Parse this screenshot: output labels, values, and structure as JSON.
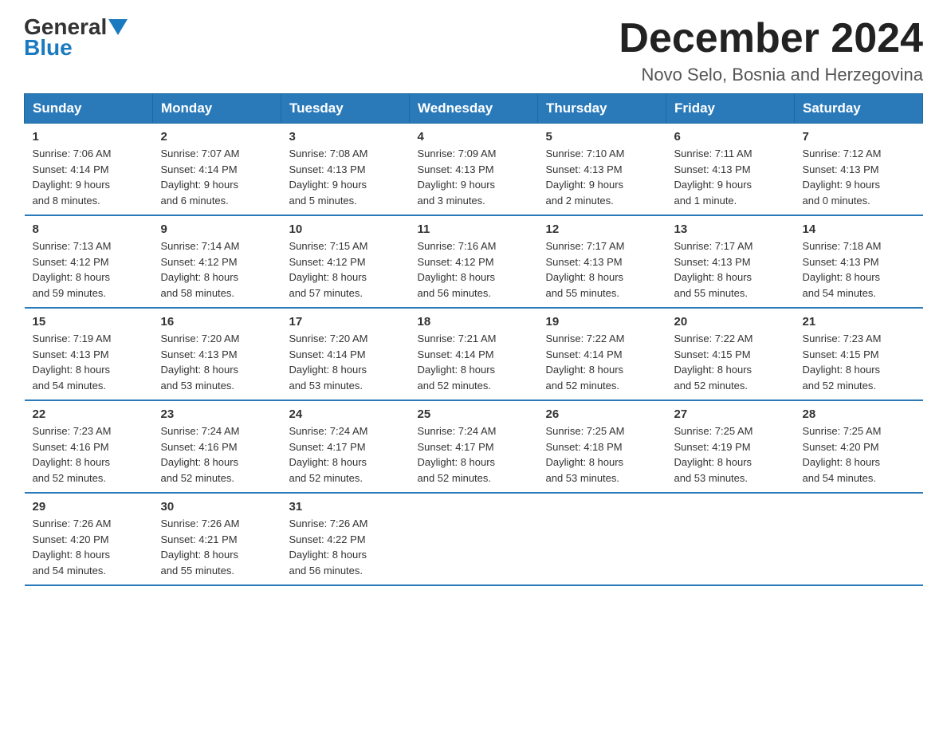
{
  "logo": {
    "general": "General",
    "blue": "Blue"
  },
  "title": "December 2024",
  "location": "Novo Selo, Bosnia and Herzegovina",
  "headers": [
    "Sunday",
    "Monday",
    "Tuesday",
    "Wednesday",
    "Thursday",
    "Friday",
    "Saturday"
  ],
  "weeks": [
    [
      {
        "day": "1",
        "sunrise": "7:06 AM",
        "sunset": "4:14 PM",
        "daylight": "9 hours and 8 minutes."
      },
      {
        "day": "2",
        "sunrise": "7:07 AM",
        "sunset": "4:14 PM",
        "daylight": "9 hours and 6 minutes."
      },
      {
        "day": "3",
        "sunrise": "7:08 AM",
        "sunset": "4:13 PM",
        "daylight": "9 hours and 5 minutes."
      },
      {
        "day": "4",
        "sunrise": "7:09 AM",
        "sunset": "4:13 PM",
        "daylight": "9 hours and 3 minutes."
      },
      {
        "day": "5",
        "sunrise": "7:10 AM",
        "sunset": "4:13 PM",
        "daylight": "9 hours and 2 minutes."
      },
      {
        "day": "6",
        "sunrise": "7:11 AM",
        "sunset": "4:13 PM",
        "daylight": "9 hours and 1 minute."
      },
      {
        "day": "7",
        "sunrise": "7:12 AM",
        "sunset": "4:13 PM",
        "daylight": "9 hours and 0 minutes."
      }
    ],
    [
      {
        "day": "8",
        "sunrise": "7:13 AM",
        "sunset": "4:12 PM",
        "daylight": "8 hours and 59 minutes."
      },
      {
        "day": "9",
        "sunrise": "7:14 AM",
        "sunset": "4:12 PM",
        "daylight": "8 hours and 58 minutes."
      },
      {
        "day": "10",
        "sunrise": "7:15 AM",
        "sunset": "4:12 PM",
        "daylight": "8 hours and 57 minutes."
      },
      {
        "day": "11",
        "sunrise": "7:16 AM",
        "sunset": "4:12 PM",
        "daylight": "8 hours and 56 minutes."
      },
      {
        "day": "12",
        "sunrise": "7:17 AM",
        "sunset": "4:13 PM",
        "daylight": "8 hours and 55 minutes."
      },
      {
        "day": "13",
        "sunrise": "7:17 AM",
        "sunset": "4:13 PM",
        "daylight": "8 hours and 55 minutes."
      },
      {
        "day": "14",
        "sunrise": "7:18 AM",
        "sunset": "4:13 PM",
        "daylight": "8 hours and 54 minutes."
      }
    ],
    [
      {
        "day": "15",
        "sunrise": "7:19 AM",
        "sunset": "4:13 PM",
        "daylight": "8 hours and 54 minutes."
      },
      {
        "day": "16",
        "sunrise": "7:20 AM",
        "sunset": "4:13 PM",
        "daylight": "8 hours and 53 minutes."
      },
      {
        "day": "17",
        "sunrise": "7:20 AM",
        "sunset": "4:14 PM",
        "daylight": "8 hours and 53 minutes."
      },
      {
        "day": "18",
        "sunrise": "7:21 AM",
        "sunset": "4:14 PM",
        "daylight": "8 hours and 52 minutes."
      },
      {
        "day": "19",
        "sunrise": "7:22 AM",
        "sunset": "4:14 PM",
        "daylight": "8 hours and 52 minutes."
      },
      {
        "day": "20",
        "sunrise": "7:22 AM",
        "sunset": "4:15 PM",
        "daylight": "8 hours and 52 minutes."
      },
      {
        "day": "21",
        "sunrise": "7:23 AM",
        "sunset": "4:15 PM",
        "daylight": "8 hours and 52 minutes."
      }
    ],
    [
      {
        "day": "22",
        "sunrise": "7:23 AM",
        "sunset": "4:16 PM",
        "daylight": "8 hours and 52 minutes."
      },
      {
        "day": "23",
        "sunrise": "7:24 AM",
        "sunset": "4:16 PM",
        "daylight": "8 hours and 52 minutes."
      },
      {
        "day": "24",
        "sunrise": "7:24 AM",
        "sunset": "4:17 PM",
        "daylight": "8 hours and 52 minutes."
      },
      {
        "day": "25",
        "sunrise": "7:24 AM",
        "sunset": "4:17 PM",
        "daylight": "8 hours and 52 minutes."
      },
      {
        "day": "26",
        "sunrise": "7:25 AM",
        "sunset": "4:18 PM",
        "daylight": "8 hours and 53 minutes."
      },
      {
        "day": "27",
        "sunrise": "7:25 AM",
        "sunset": "4:19 PM",
        "daylight": "8 hours and 53 minutes."
      },
      {
        "day": "28",
        "sunrise": "7:25 AM",
        "sunset": "4:20 PM",
        "daylight": "8 hours and 54 minutes."
      }
    ],
    [
      {
        "day": "29",
        "sunrise": "7:26 AM",
        "sunset": "4:20 PM",
        "daylight": "8 hours and 54 minutes."
      },
      {
        "day": "30",
        "sunrise": "7:26 AM",
        "sunset": "4:21 PM",
        "daylight": "8 hours and 55 minutes."
      },
      {
        "day": "31",
        "sunrise": "7:26 AM",
        "sunset": "4:22 PM",
        "daylight": "8 hours and 56 minutes."
      },
      null,
      null,
      null,
      null
    ]
  ],
  "labels": {
    "sunrise": "Sunrise:",
    "sunset": "Sunset:",
    "daylight": "Daylight:"
  }
}
